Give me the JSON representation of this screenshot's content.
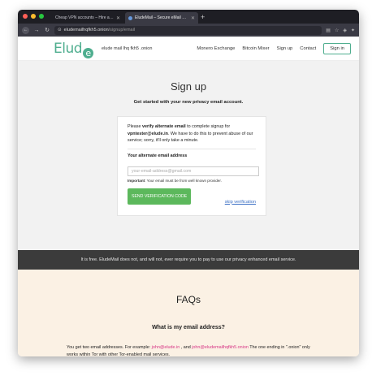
{
  "browser": {
    "tabs": [
      {
        "title": "Cheap VPN accounts – Hire a Hacke"
      },
      {
        "title": "EludeMail – Secure eMail Servi"
      }
    ],
    "new_tab": "+",
    "url_host": "eludemailhqfkh5.onion",
    "url_path": "/signup/email"
  },
  "header": {
    "logo_text": "Elud",
    "logo_e": "e",
    "subtitle": "elude mail lhq fkh5 .onion",
    "nav": {
      "monero": "Monero Exchange",
      "bitcoin": "Bitcoin Mixer",
      "signup": "Sign up",
      "contact": "Contact",
      "signin": "Sign in"
    }
  },
  "signup": {
    "title": "Sign up",
    "subtitle": "Get started with your new privacy email account.",
    "msg_pre": "Please ",
    "msg_bold": "verify alternate email",
    "msg_mid": " to complete signup for ",
    "msg_email": "vpntester@elude.in",
    "msg_post": ". We have to do this to prevent abuse of our service; sorry, it'll only take a minute.",
    "field_label": "Your alternate email address",
    "input_placeholder": "your-email-address@gmail.com",
    "input_value": "",
    "important_label": "Important",
    "important_text": ": Your email must be from well known provider.",
    "send_button": "SEND VERIFICATION CODE",
    "skip_link": "skip verification"
  },
  "banner": {
    "text": "It is free. EludeMail does not, and will not, ever require you to pay to use our privacy enhanced email service."
  },
  "faq": {
    "title": "FAQs",
    "question": "What is my email address?",
    "answer_pre": "You get two email addresses. For example: ",
    "addr1": "john@elude.in",
    "answer_and": " , and ",
    "addr2": "john@eludemailhqfkh5.onion",
    "answer_post": " The one ending in \".onion\" only works within Tor with other Tor-enabled mail services."
  },
  "colors": {
    "brand_green": "#4fae8f",
    "button_green": "#5cb85c",
    "banner_bg": "#3b3b3b",
    "faq_bg": "#fbf1e4",
    "link_blue": "#3a6fc4",
    "email_pink": "#d63384"
  }
}
